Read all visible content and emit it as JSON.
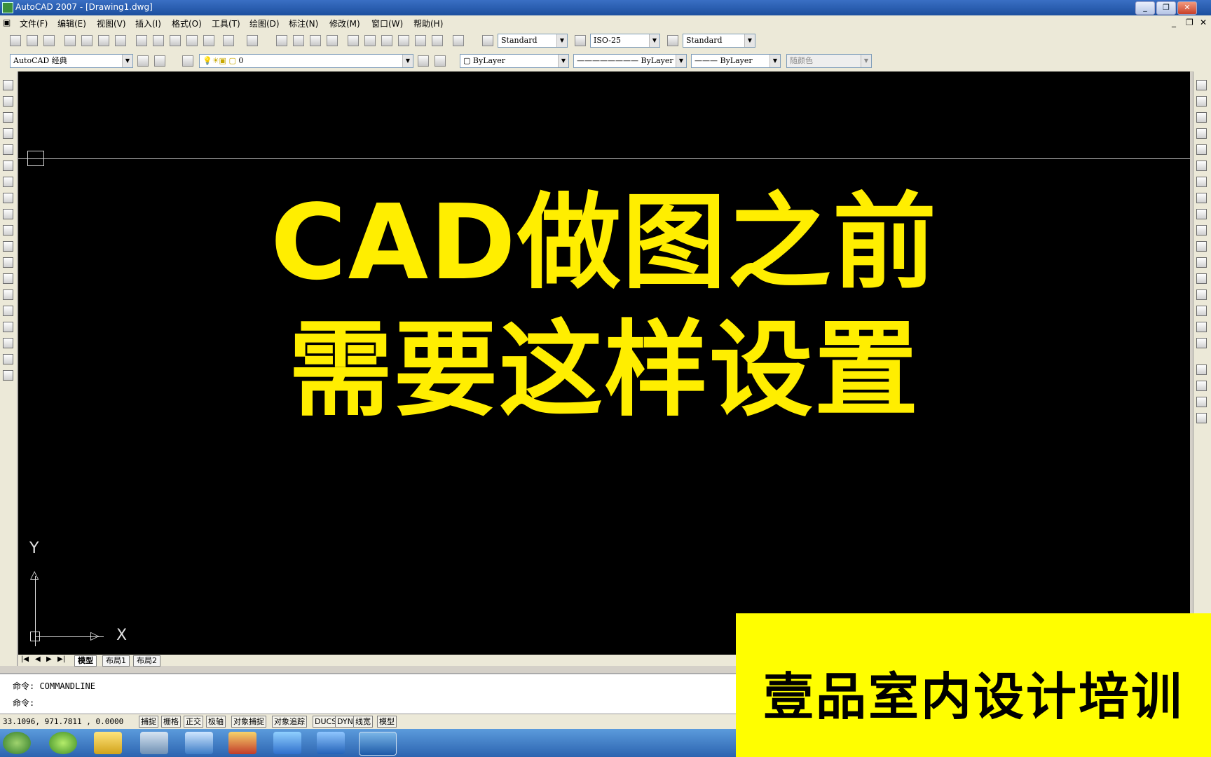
{
  "window": {
    "title": "AutoCAD 2007 - [Drawing1.dwg]"
  },
  "menu": [
    "文件(F)",
    "编辑(E)",
    "视图(V)",
    "插入(I)",
    "格式(O)",
    "工具(T)",
    "绘图(D)",
    "标注(N)",
    "修改(M)",
    "窗口(W)",
    "帮助(H)"
  ],
  "styles": {
    "text_style": "Standard",
    "dim_style": "ISO-25",
    "table_style": "Standard"
  },
  "workspace": {
    "name": "AutoCAD 经典"
  },
  "layer": {
    "current": "0"
  },
  "properties": {
    "color": "ByLayer",
    "linetype": "ByLayer",
    "lineweight": "ByLayer",
    "plotstyle": "随颜色"
  },
  "overlay": {
    "line1": "CAD做图之前",
    "line2": "需要这样设置"
  },
  "ucs": {
    "x_label": "X",
    "y_label": "Y"
  },
  "layout_tabs": [
    "模型",
    "布局1",
    "布局2"
  ],
  "command": {
    "line1": "命令: COMMANDLINE",
    "line2": "命令:"
  },
  "status": {
    "coords": "33.1096,  971.7811 , 0.0000",
    "toggles": [
      "捕捉",
      "栅格",
      "正交",
      "极轴",
      "对象捕捉",
      "对象追踪",
      "DUCS",
      "DYN",
      "线宽",
      "模型"
    ]
  },
  "brand": {
    "text": "壹品室内设计培训"
  },
  "colors": {
    "canvas": "#000000",
    "headline": "#ffee00",
    "brand_bg": "#fffe00"
  }
}
